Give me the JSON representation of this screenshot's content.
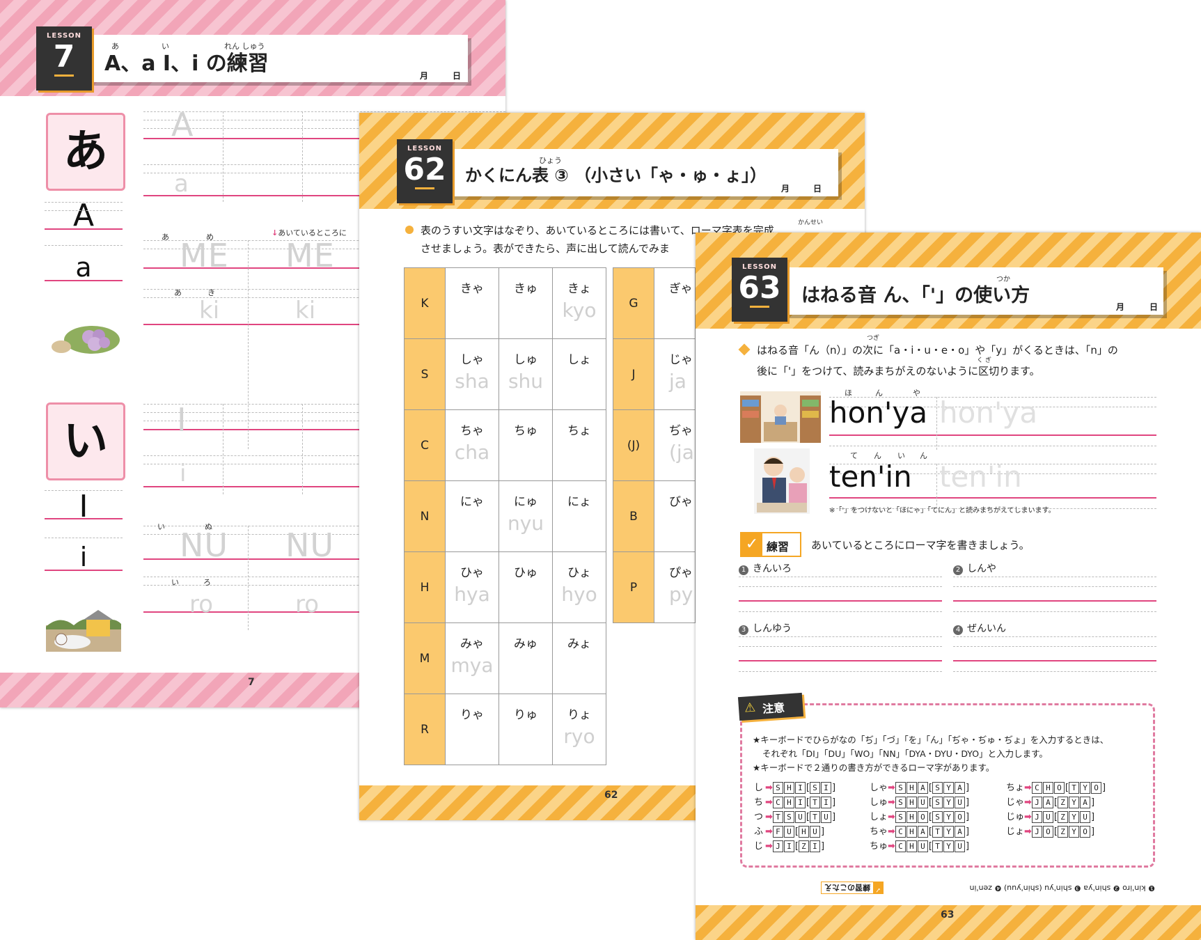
{
  "page7": {
    "lesson_label": "LESSON",
    "lesson_number": "7",
    "title": "A、a I、i の練習",
    "title_ruby": [
      "あ",
      "い",
      "れん しゅう"
    ],
    "month": "月",
    "day": "日",
    "kana1": "あ",
    "letter1_upper": "A",
    "letter1_lower": "a",
    "kana2": "い",
    "letter2_upper": "I",
    "letter2_lower": "i",
    "trace1_upper": "A",
    "trace1_lower": "a",
    "trace2_upper": "I",
    "trace2_lower": "i",
    "hint": "あいているところに",
    "words": [
      {
        "ruby": [
          "あ",
          "め"
        ],
        "text": "ME"
      },
      {
        "ruby": [
          "あ",
          "き"
        ],
        "text": "ki"
      },
      {
        "ruby": [
          "い",
          "ぬ"
        ],
        "text": "NU"
      },
      {
        "ruby": [
          "い",
          "ろ"
        ],
        "text": "ro"
      }
    ],
    "page_number": "7"
  },
  "page62": {
    "lesson_label": "LESSON",
    "lesson_number": "62",
    "title": "かくにん表 ③ （小さい「ゃ・ゅ・ょ」）",
    "title_ruby": "ひょう",
    "month": "月",
    "day": "日",
    "instruction_line1": "表のうすい文字はなぞり、あいているところには書いて、ローマ字表を完成",
    "instruction_line2": "させましょう。表ができたら、声に出して読んでみま",
    "instruction_ruby": "かんせい",
    "table_left": [
      {
        "cons": "K",
        "cells": [
          {
            "k": "きゃ",
            "r": ""
          },
          {
            "k": "きゅ",
            "r": ""
          },
          {
            "k": "きょ",
            "r": "kyo"
          }
        ]
      },
      {
        "cons": "S",
        "cells": [
          {
            "k": "しゃ",
            "r": "sha"
          },
          {
            "k": "しゅ",
            "r": "shu"
          },
          {
            "k": "しょ",
            "r": ""
          }
        ]
      },
      {
        "cons": "C",
        "cells": [
          {
            "k": "ちゃ",
            "r": "cha"
          },
          {
            "k": "ちゅ",
            "r": ""
          },
          {
            "k": "ちょ",
            "r": ""
          }
        ]
      },
      {
        "cons": "N",
        "cells": [
          {
            "k": "にゃ",
            "r": ""
          },
          {
            "k": "にゅ",
            "r": "nyu"
          },
          {
            "k": "にょ",
            "r": ""
          }
        ]
      },
      {
        "cons": "H",
        "cells": [
          {
            "k": "ひゃ",
            "r": "hya"
          },
          {
            "k": "ひゅ",
            "r": ""
          },
          {
            "k": "ひょ",
            "r": "hyo"
          }
        ]
      },
      {
        "cons": "M",
        "cells": [
          {
            "k": "みゃ",
            "r": "mya"
          },
          {
            "k": "みゅ",
            "r": ""
          },
          {
            "k": "みょ",
            "r": ""
          }
        ]
      },
      {
        "cons": "R",
        "cells": [
          {
            "k": "りゃ",
            "r": ""
          },
          {
            "k": "りゅ",
            "r": ""
          },
          {
            "k": "りょ",
            "r": "ryo"
          }
        ]
      }
    ],
    "table_right": [
      {
        "cons": "G",
        "k": "ぎゃ",
        "r": ""
      },
      {
        "cons": "J",
        "k": "じゃ",
        "r": "ja"
      },
      {
        "cons": "(J)",
        "k": "ぢゃ",
        "r": "(ja"
      },
      {
        "cons": "B",
        "k": "びゃ",
        "r": ""
      },
      {
        "cons": "P",
        "k": "ぴゃ",
        "r": "py"
      }
    ],
    "page_number": "62"
  },
  "page63": {
    "lesson_label": "LESSON",
    "lesson_number": "63",
    "title": "はねる音 ん、「'」の使い方",
    "title_ruby": "つか",
    "month": "月",
    "day": "日",
    "intro_line1": "はねる音「ん（n）」の次に「a・i・u・e・o」や「y」がくるときは、「n」の",
    "intro_line2": "後に「'」をつけて、読みまちがえのないように区切ります。",
    "intro_ruby1": "つぎ",
    "intro_ruby2": "く ぎ",
    "example1": {
      "ruby": [
        "ほ",
        "ん",
        "や"
      ],
      "text": "hon'ya",
      "trace": "hon'ya"
    },
    "example2": {
      "ruby": [
        "て",
        "ん",
        "い",
        "ん"
      ],
      "text": "ten'in",
      "trace": "ten'in"
    },
    "example_note": "※「'」をつけないと「ほにゃ」「てにん」と読みまちがえてしまいます。",
    "practice_label": "練習",
    "practice_instruction": "あいているところにローマ字を書きましょう。",
    "practice_items": [
      {
        "num": "1",
        "word": "きんいろ"
      },
      {
        "num": "2",
        "word": "しんや"
      },
      {
        "num": "3",
        "word": "しんゆう"
      },
      {
        "num": "4",
        "word": "ぜんいん"
      }
    ],
    "caution_label": "注意",
    "caution_line1": "★キーボードでひらがなの「ぢ」「づ」「を」「ん」「ぢゃ・ぢゅ・ぢょ」を入力するときは、",
    "caution_line2": "それぞれ「DI」「DU」「WO」「NN」「DYA・DYU・DYO」と入力します。",
    "caution_line3": "★キーボードで２通りの書き方ができるローマ字があります。",
    "key_map_col1": [
      {
        "kana": "し",
        "main": "SHI",
        "alt": "SI"
      },
      {
        "kana": "ち",
        "main": "CHI",
        "alt": "TI"
      },
      {
        "kana": "つ",
        "main": "TSU",
        "alt": "TU"
      },
      {
        "kana": "ふ",
        "main": "FU",
        "alt": "HU"
      },
      {
        "kana": "じ",
        "main": "JI",
        "alt": "ZI"
      }
    ],
    "key_map_col2": [
      {
        "kana": "しゃ",
        "main": "SHA",
        "alt": "SYA"
      },
      {
        "kana": "しゅ",
        "main": "SHU",
        "alt": "SYU"
      },
      {
        "kana": "しょ",
        "main": "SHO",
        "alt": "SYO"
      },
      {
        "kana": "ちゃ",
        "main": "CHA",
        "alt": "TYA"
      },
      {
        "kana": "ちゅ",
        "main": "CHU",
        "alt": "TYU"
      }
    ],
    "key_map_col3": [
      {
        "kana": "ちょ",
        "main": "CHO",
        "alt": "TYO"
      },
      {
        "kana": "じゃ",
        "main": "JA",
        "alt": "ZYA"
      },
      {
        "kana": "じゅ",
        "main": "JU",
        "alt": "ZYU"
      },
      {
        "kana": "じょ",
        "main": "JO",
        "alt": "ZYO"
      }
    ],
    "answers_label": "練習のこたえ",
    "answers": "❶ kin'iro ❷ shin'ya ❸ shin'yu (shin'yuu) ❹ zen'in",
    "page_number": "63"
  }
}
